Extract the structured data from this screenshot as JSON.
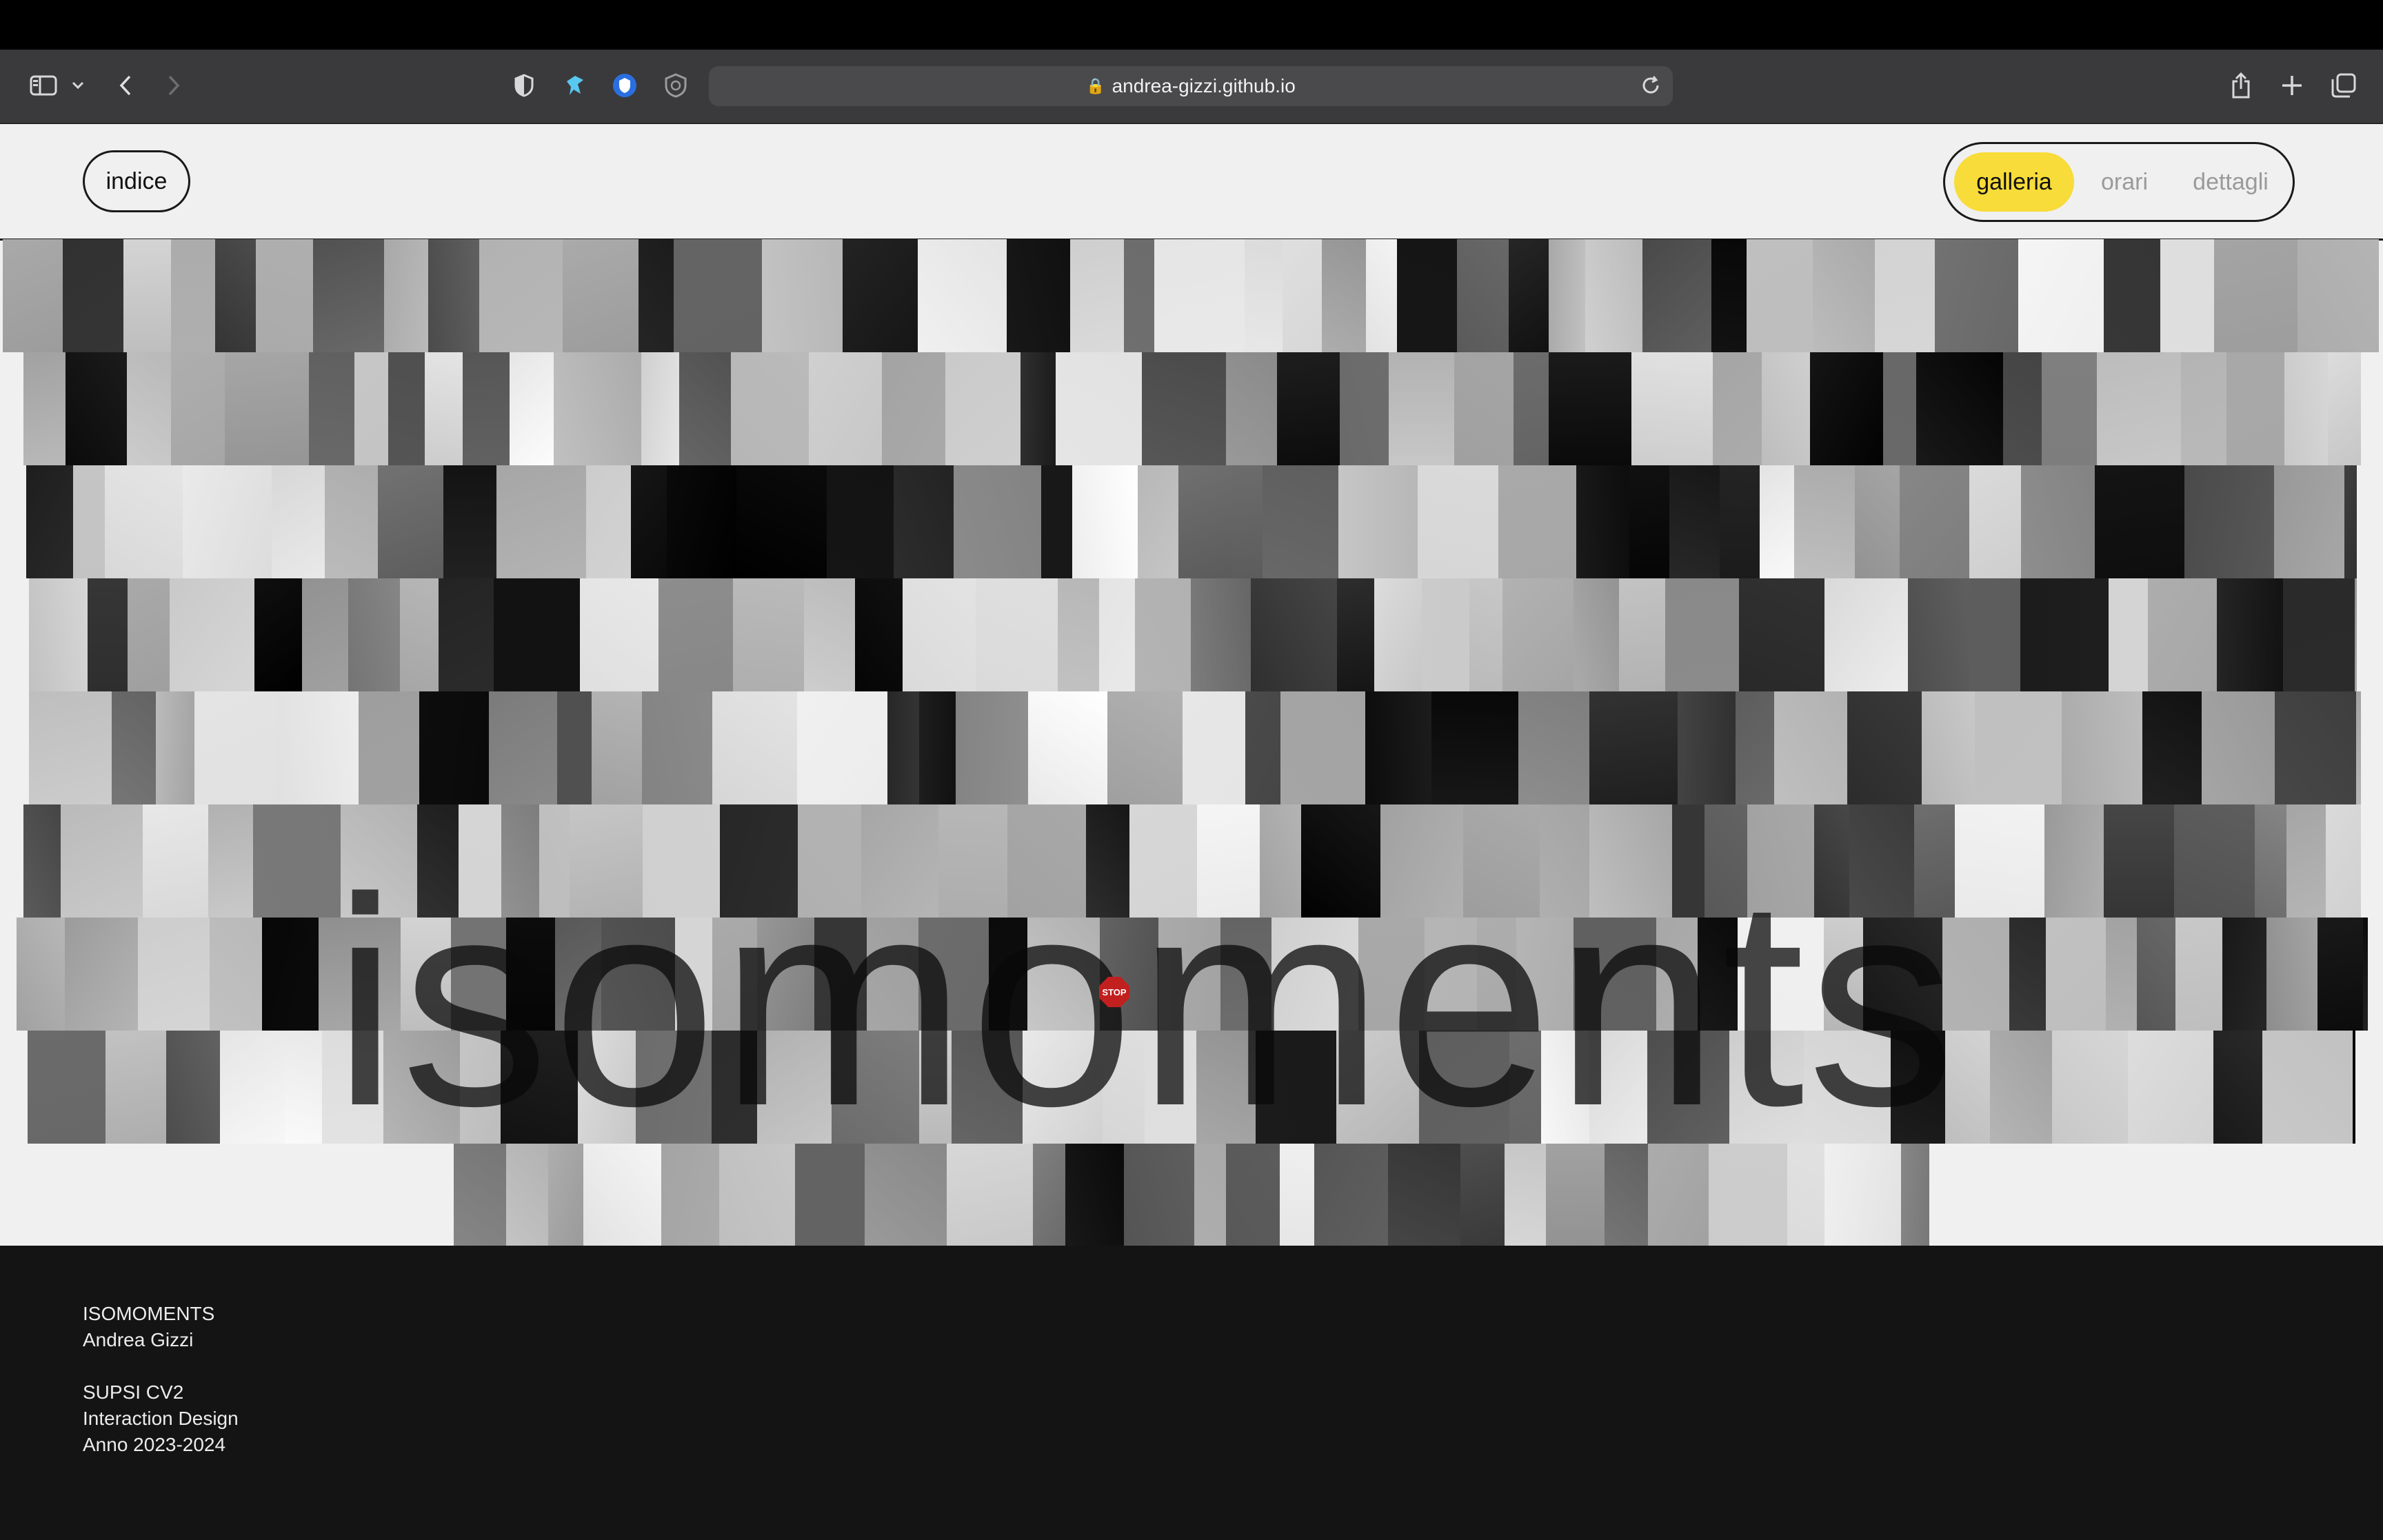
{
  "browser": {
    "url": "andrea-gizzi.github.io",
    "lock_glyph": "🔒",
    "icons": [
      "sidebar-icon",
      "chevron-down-icon",
      "back-icon",
      "forward-icon",
      "shield-icon",
      "extension-icon",
      "privacy-icon",
      "adblock-icon",
      "reload-icon",
      "share-icon",
      "new-tab-icon",
      "tabs-overview-icon"
    ]
  },
  "header": {
    "indice_label": "indice",
    "nav": {
      "galleria": "galleria",
      "orari": "orari",
      "dettagli": "dettagli",
      "active": "galleria"
    }
  },
  "hero": {
    "title": "isomoments",
    "stop_sign": "STOP"
  },
  "colors": {
    "accent_yellow": "#f7dc3a",
    "footer_bg": "#141414",
    "page_bg": "#f0f0f0"
  },
  "footer": {
    "project": "ISOMOMENTS",
    "author": "Andrea Gizzi",
    "school": "SUPSI CV2",
    "course": "Interaction Design",
    "year": "Anno 2023-2024"
  }
}
